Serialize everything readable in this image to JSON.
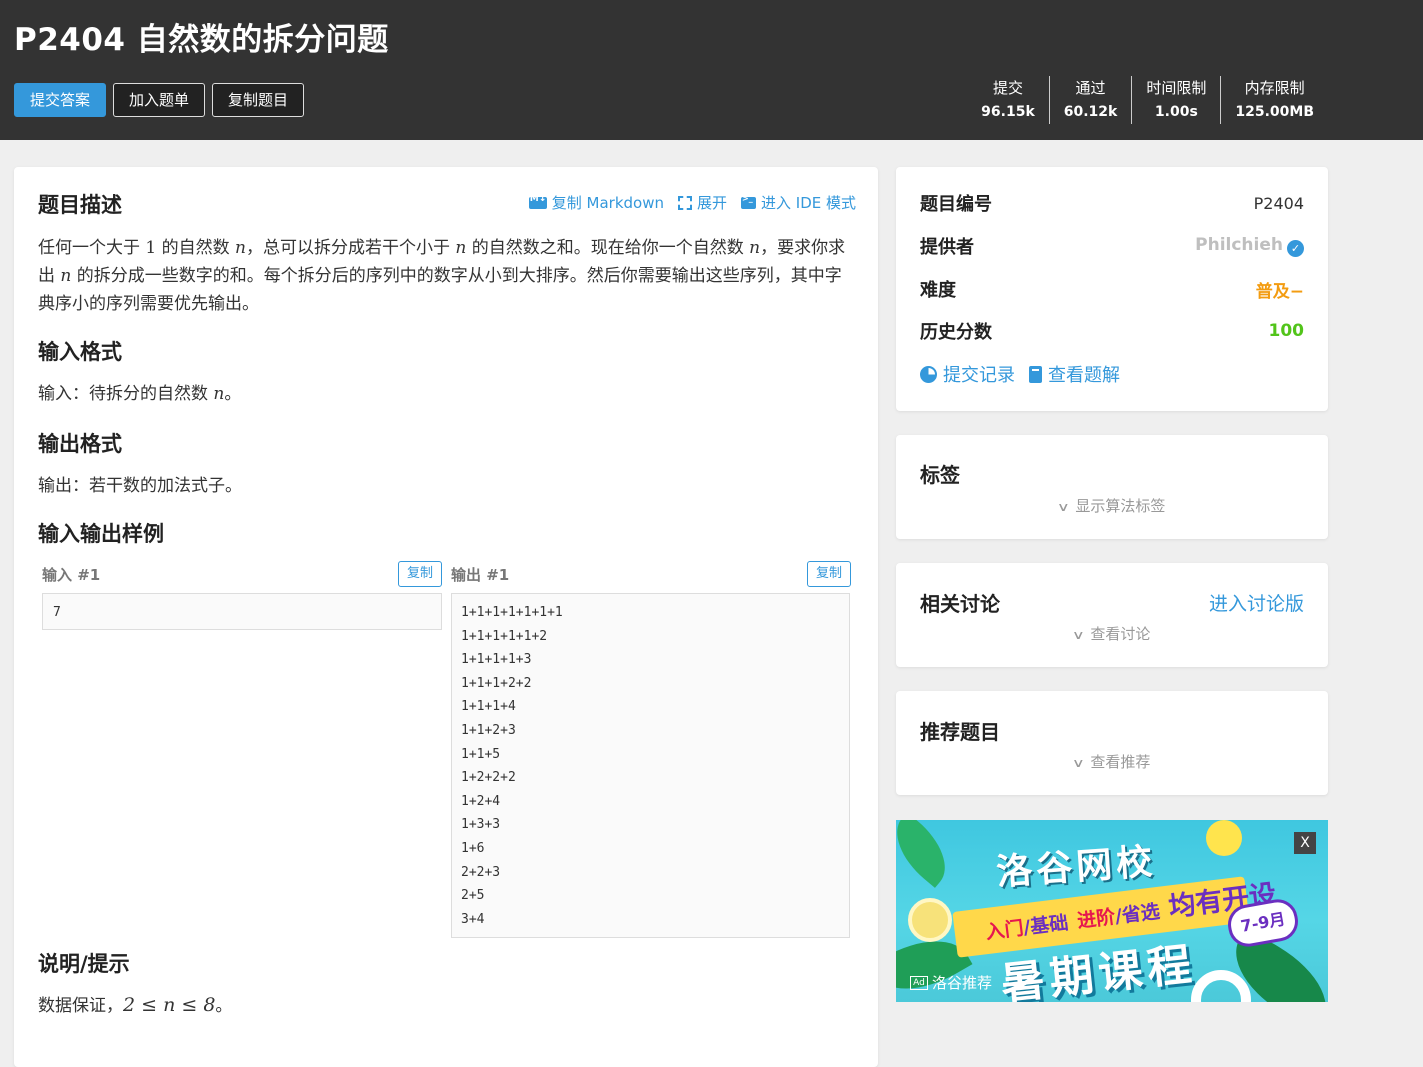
{
  "header": {
    "title": "P2404 自然数的拆分问题",
    "buttons": {
      "submit": "提交答案",
      "add_to_list": "加入题单",
      "copy_problem": "复制题目"
    },
    "stats": [
      {
        "label": "提交",
        "value": "96.15k"
      },
      {
        "label": "通过",
        "value": "60.12k"
      },
      {
        "label": "时间限制",
        "value": "1.00s"
      },
      {
        "label": "内存限制",
        "value": "125.00MB"
      }
    ]
  },
  "problem": {
    "ops": {
      "copy_markdown": "复制 Markdown",
      "expand": "展开",
      "ide_mode": "进入 IDE 模式"
    },
    "description": {
      "heading": "题目描述",
      "p1": "任何一个大于",
      "m1": "1",
      "p2": "的自然数",
      "m2": "n",
      "p3": "，总可以拆分成若干个小于",
      "m3": "n",
      "p4": "的自然数之和。现在给你一个自然数",
      "m4": "n",
      "p5": "，要求你求出",
      "m5": "n",
      "p6": "的拆分成一些数字的和。每个拆分后的序列中的数字从小到大排序。然后你需要输出这些序列，其中字典序小的序列需要优先输出。"
    },
    "input_format": {
      "heading": "输入格式",
      "text": "输入：待拆分的自然数",
      "math": "n",
      "tail": "。"
    },
    "output_format": {
      "heading": "输出格式",
      "text": "输出：若干数的加法式子。"
    },
    "samples": {
      "heading": "输入输出样例",
      "input_label": "输入 #1",
      "output_label": "输出 #1",
      "copy_label": "复制",
      "input_lines": [
        "7"
      ],
      "output_lines": [
        "1+1+1+1+1+1+1",
        "1+1+1+1+1+2",
        "1+1+1+1+3",
        "1+1+1+2+2",
        "1+1+1+4",
        "1+1+2+3",
        "1+1+5",
        "1+2+2+2",
        "1+2+4",
        "1+3+3",
        "1+6",
        "2+2+3",
        "2+5",
        "3+4"
      ]
    },
    "hint": {
      "heading": "说明/提示",
      "text": "数据保证，",
      "math": "2 ≤ n ≤ 8",
      "tail": "。"
    }
  },
  "info_card": {
    "rows": [
      {
        "key": "题目编号",
        "value": "P2404"
      },
      {
        "key": "提供者",
        "value": "Philchieh"
      },
      {
        "key": "难度",
        "value": "普及−"
      },
      {
        "key": "历史分数",
        "value": "100"
      }
    ],
    "links": {
      "records": "提交记录",
      "solutions": "查看题解"
    },
    "colors": {
      "provider": "#bfbfbf",
      "difficulty": "#f39c11",
      "score": "#52c41a"
    }
  },
  "tags_card": {
    "title": "标签",
    "toggle": "显示算法标签"
  },
  "discuss_card": {
    "title": "相关讨论",
    "link": "进入讨论版",
    "toggle": "查看讨论"
  },
  "recommend_card": {
    "title": "推荐题目",
    "toggle": "查看推荐"
  },
  "ad": {
    "close": "X",
    "brand": "洛谷网校",
    "line_a1": "入门",
    "line_a2": "/基础",
    "line_b1": "进阶",
    "line_b2": "/省选",
    "line_c": "均有开设",
    "main": "暑期课程",
    "months": "7-9月",
    "badge": "Ad",
    "tag": "洛谷推荐"
  },
  "accent": "#3498db"
}
